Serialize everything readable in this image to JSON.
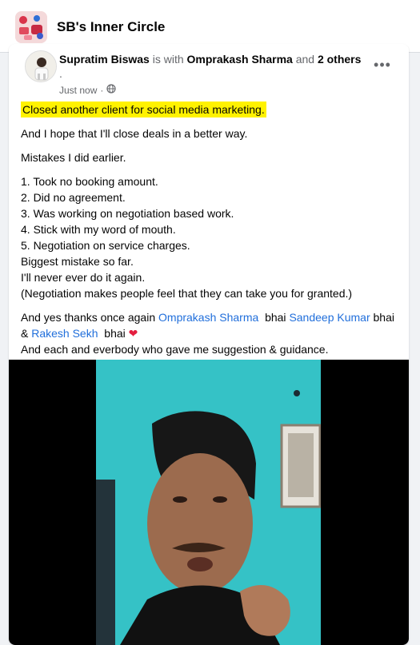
{
  "group": {
    "name": "SB's Inner Circle",
    "avatar_icon": "group-avatar-image"
  },
  "post": {
    "author": "Supratim Biswas",
    "with_text": "is with",
    "tagged": "Omprakash Sharma",
    "and_text": "and",
    "others": "2 others",
    "trail": ".",
    "time": "Just now",
    "separator": "·",
    "privacy_icon": "globe-icon",
    "more_label": "•••",
    "highlight": "Closed another client for social media marketing.",
    "line_hope": "And I hope that I'll close deals in a better way.",
    "line_mistakes": "Mistakes I did earlier.",
    "list": [
      "1. Took no  booking amount.",
      "2. Did no agreement.",
      "3. Was working on negotiation based work.",
      "4. Stick with my word of mouth.",
      "5. Negotiation on service charges."
    ],
    "line_biggest": "Biggest mistake so far.",
    "line_never": "I'll never ever do it again.",
    "line_paren": "(Negotiation makes people feel that they can take you for granted.)",
    "thanks_prefix": "And yes thanks once again",
    "mention_1": "Omprakash Sharma",
    "bhai_1": "bhai",
    "mention_2": "Sandeep Kumar",
    "bhai_2": "bhai &",
    "mention_3": "Rakesh Sekh",
    "bhai_3": "bhai",
    "heart": "❤",
    "closing": "And each and everbody who gave me suggestion & guidance."
  }
}
